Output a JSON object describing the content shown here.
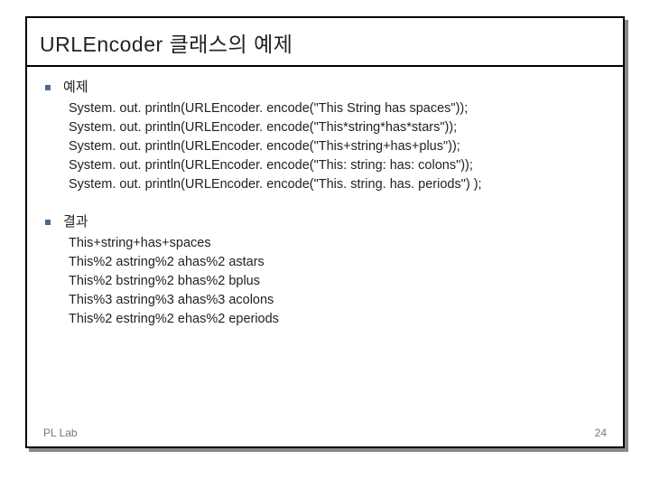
{
  "slide": {
    "title": "URLEncoder 클래스의 예제",
    "sections": [
      {
        "label": "예제",
        "lines": [
          "System. out. println(URLEncoder. encode(\"This String has spaces\"));",
          "System. out. println(URLEncoder. encode(\"This*string*has*stars\"));",
          "System. out. println(URLEncoder. encode(\"This+string+has+plus\"));",
          "System. out. println(URLEncoder. encode(\"This: string: has: colons\"));",
          "System. out. println(URLEncoder. encode(\"This. string. has. periods\") );"
        ]
      },
      {
        "label": "결과",
        "lines": [
          "This+string+has+spaces",
          "This%2 astring%2 ahas%2 astars",
          "This%2 bstring%2 bhas%2 bplus",
          "This%3 astring%3 ahas%3 acolons",
          "This%2 estring%2 ehas%2 eperiods"
        ]
      }
    ],
    "footer_left": "PL Lab",
    "footer_right": "24"
  }
}
